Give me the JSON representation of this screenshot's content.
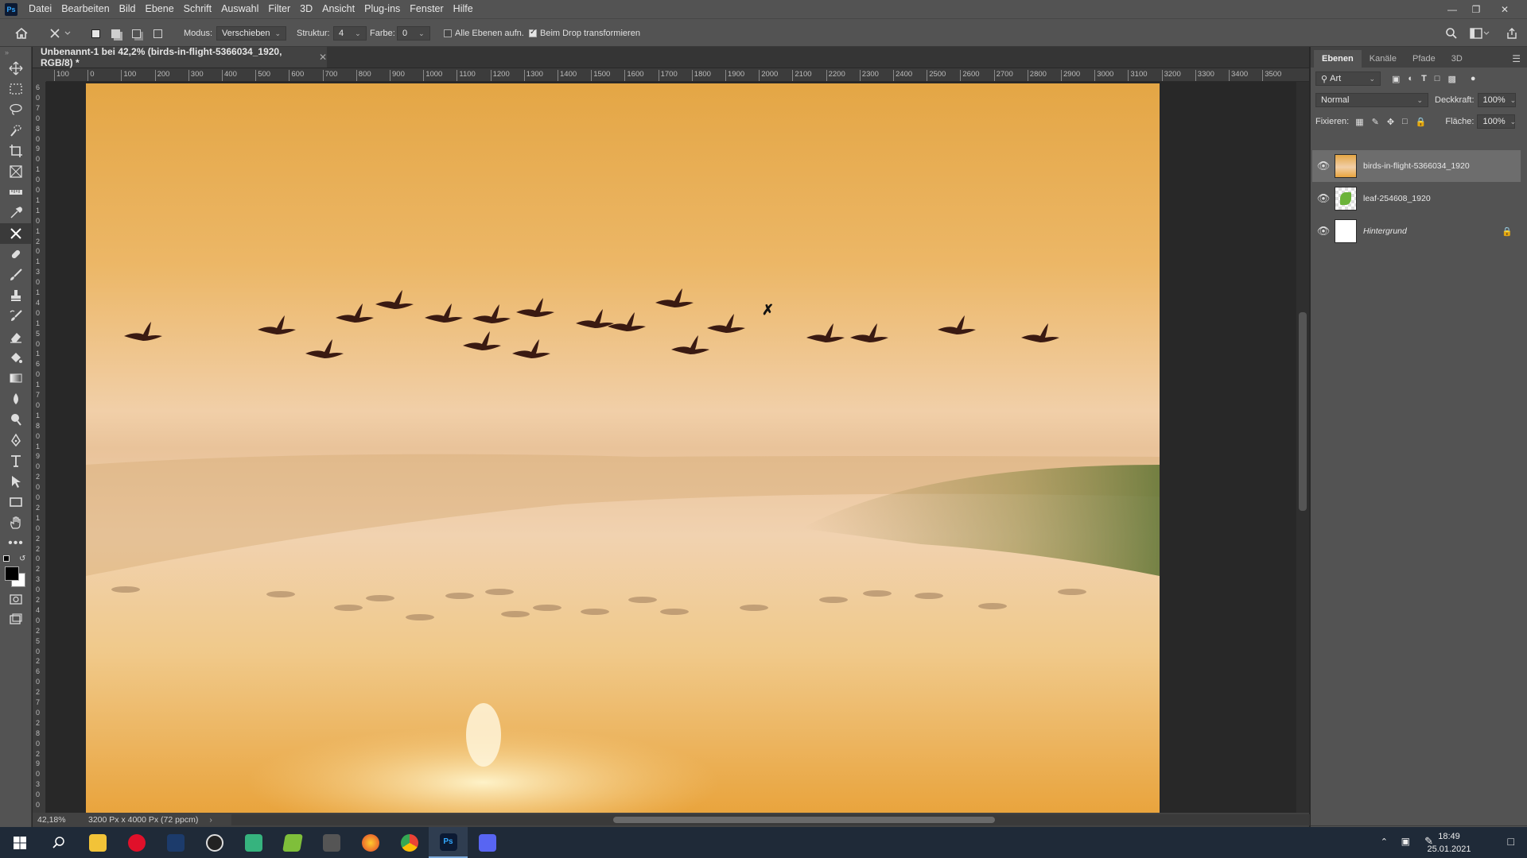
{
  "app": {
    "logo": "Ps"
  },
  "menu": [
    "Datei",
    "Bearbeiten",
    "Bild",
    "Ebene",
    "Schrift",
    "Auswahl",
    "Filter",
    "3D",
    "Ansicht",
    "Plug-ins",
    "Fenster",
    "Hilfe"
  ],
  "options": {
    "mode_label": "Modus:",
    "mode_value": "Verschieben",
    "structure_label": "Struktur:",
    "structure_value": "4",
    "color_label": "Farbe:",
    "color_value": "0",
    "sample_all_label": "Alle Ebenen aufn.",
    "sample_all_checked": false,
    "transform_on_drop_label": "Beim Drop transformieren",
    "transform_on_drop_checked": true
  },
  "document": {
    "tab_title": "Unbenannt-1 bei 42,2% (birds-in-flight-5366034_1920, RGB/8) *",
    "ruler_h": [
      "100",
      "0",
      "100",
      "200",
      "300",
      "400",
      "500",
      "600",
      "700",
      "800",
      "900",
      "1000",
      "1100",
      "1200",
      "1300",
      "1400",
      "1500",
      "1600",
      "1700",
      "1800",
      "1900",
      "2000",
      "2100",
      "2200",
      "2300",
      "2400",
      "2500",
      "2600",
      "2700",
      "2800",
      "2900",
      "3000",
      "3100",
      "3200",
      "3300",
      "3400",
      "3500"
    ],
    "ruler_v": [
      "6",
      "0",
      "7",
      "0",
      "8",
      "0",
      "9",
      "0",
      "1",
      "0",
      "0",
      "1",
      "1",
      "0",
      "1",
      "2",
      "0",
      "1",
      "3",
      "0",
      "1",
      "4",
      "0",
      "1",
      "5",
      "0",
      "1",
      "6",
      "0",
      "1",
      "7",
      "0",
      "1",
      "8",
      "0",
      "1",
      "9",
      "0",
      "2",
      "0",
      "0",
      "2",
      "1",
      "0",
      "2",
      "2",
      "0",
      "2",
      "3",
      "0",
      "2",
      "4",
      "0",
      "2",
      "5",
      "0",
      "2",
      "6",
      "0",
      "2",
      "7",
      "0",
      "2",
      "8",
      "0",
      "2",
      "9",
      "0",
      "3",
      "0",
      "0"
    ]
  },
  "status": {
    "zoom": "42,18%",
    "doc_size": "3200 Px x 4000 Px (72 ppcm)"
  },
  "panel": {
    "tabs": [
      "Ebenen",
      "Kanäle",
      "Pfade",
      "3D"
    ],
    "active_tab": "Ebenen",
    "filter_label": "Art",
    "blend_mode": "Normal",
    "opacity_label": "Deckkraft:",
    "opacity_value": "100%",
    "lock_label": "Fixieren:",
    "fill_label": "Fläche:",
    "fill_value": "100%",
    "layers": [
      {
        "name": "birds-in-flight-5366034_1920",
        "visible": true,
        "selected": true,
        "locked": false
      },
      {
        "name": "leaf-254608_1920",
        "visible": true,
        "selected": false,
        "locked": false
      },
      {
        "name": "Hintergrund",
        "visible": true,
        "selected": false,
        "locked": true
      }
    ]
  },
  "taskbar": {
    "apps": [
      "windows-start",
      "search",
      "file-explorer",
      "opera",
      "photo-app",
      "obs",
      "chat-app",
      "layers-app",
      "keyboard-app",
      "firefox",
      "chrome",
      "photoshop",
      "discord"
    ],
    "active_app": "photoshop",
    "time": "18:49",
    "date": "25.01.2021"
  },
  "colors": {
    "accent": "#31a8ff",
    "panel_bg": "#535353",
    "canvas_sky": "#e8a94c"
  }
}
